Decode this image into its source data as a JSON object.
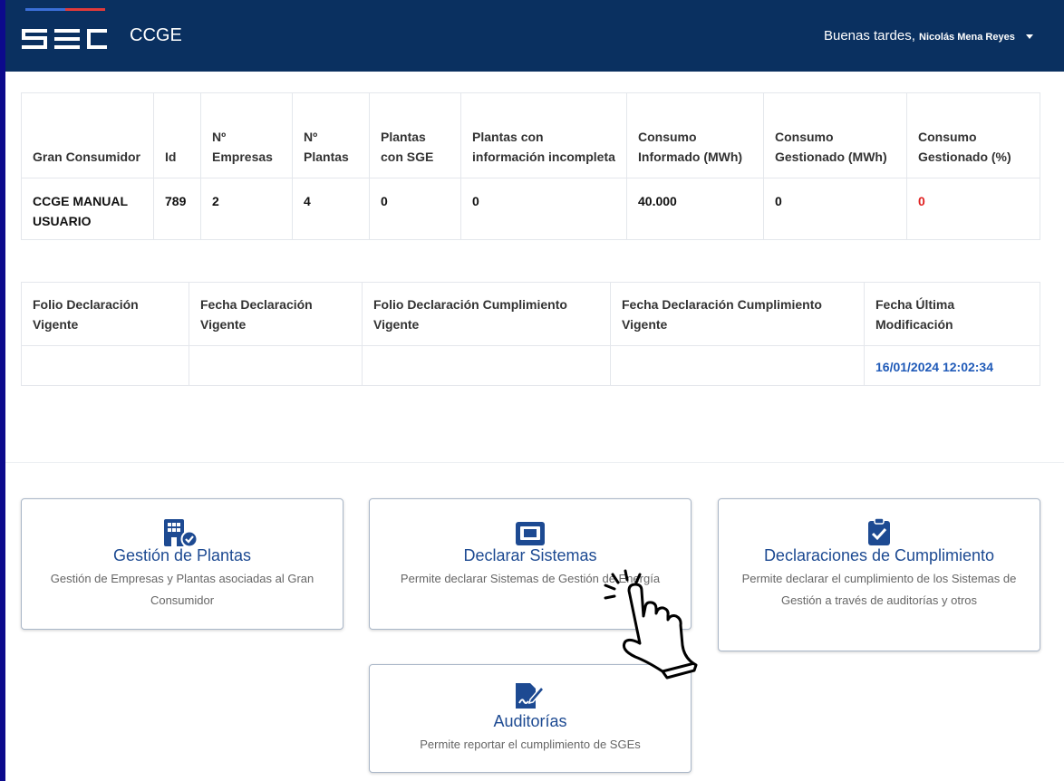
{
  "header": {
    "logo_text": "SEC",
    "app_title": "CCGE",
    "greeting": "Buenas tardes,",
    "user_name": "Nicolás Mena Reyes"
  },
  "summary_table": {
    "headers": [
      "Gran Consumidor",
      "Id",
      "Nº Empresas",
      "Nº Plantas",
      "Plantas con SGE",
      "Plantas con información incompleta",
      "Consumo Informado (MWh)",
      "Consumo Gestionado (MWh)",
      "Consumo Gestionado (%)"
    ],
    "row": [
      "CCGE MANUAL USUARIO",
      "789",
      "2",
      "4",
      "0",
      "0",
      "40.000",
      "0",
      "0"
    ]
  },
  "declaration_table": {
    "headers": [
      "Folio Declaración Vigente",
      "Fecha Declaración Vigente",
      "Folio Declaración Cumplimiento Vigente",
      "Fecha Declaración Cumplimiento Vigente",
      "Fecha Última Modificación"
    ],
    "row": [
      "",
      "",
      "",
      "",
      "16/01/2024 12:02:34"
    ]
  },
  "cards": [
    {
      "title": "Gestión de Plantas",
      "description": "Gestión de Empresas y Plantas asociadas al Gran Consumidor",
      "icon": "building-check-icon"
    },
    {
      "title": "Declarar Sistemas",
      "description": "Permite declarar Sistemas de Gestión de Energía",
      "icon": "monitor-icon"
    },
    {
      "title": "Declaraciones de Cumplimiento",
      "description": "Permite declarar el cumplimiento de los Sistemas de Gestión a través de auditorías y otros",
      "icon": "clipboard-check-icon"
    },
    {
      "title": "Auditorías",
      "description": "Permite reportar el cumplimiento de SGEs",
      "icon": "document-signature-icon"
    }
  ],
  "colors": {
    "header_bg": "#0a3060",
    "card_title": "#1d4a92",
    "alert_red": "#e02020",
    "link_blue": "#1f5ab8",
    "outer_border": "#0c0a8c"
  },
  "pointer": "hand-pointer-icon"
}
